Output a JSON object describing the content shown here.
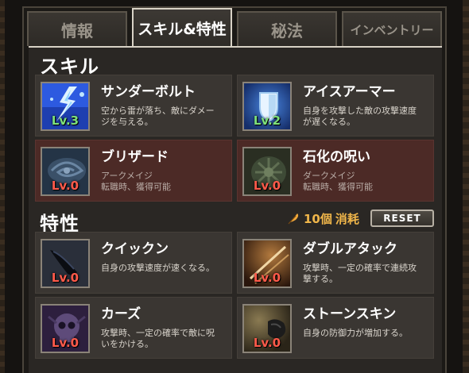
{
  "tabs": [
    {
      "label": "情報"
    },
    {
      "label": "スキル&特性"
    },
    {
      "label": "秘法"
    },
    {
      "label": "インベントリー"
    }
  ],
  "skills_section": {
    "title": "スキル"
  },
  "skills": [
    {
      "name": "サンダーボルト",
      "desc_1": "空から雷が落ち、敵にダメー",
      "desc_2": "ジを与える。",
      "level": "Lv.3",
      "icon": "thunderbolt-icon",
      "unlocked": true
    },
    {
      "name": "アイスアーマー",
      "desc_1": "自身を攻撃した敵の攻撃速度",
      "desc_2": "が遅くなる。",
      "level": "Lv.2",
      "icon": "ice-armor-icon",
      "unlocked": true
    },
    {
      "name": "ブリザード",
      "desc_1": "アークメイジ",
      "desc_2": "転職時、獲得可能",
      "level": "Lv.0",
      "icon": "blizzard-icon",
      "unlocked": false
    },
    {
      "name": "石化の呪い",
      "desc_1": "ダークメイジ",
      "desc_2": "転職時、獲得可能",
      "level": "Lv.0",
      "icon": "petrify-curse-icon",
      "unlocked": false
    }
  ],
  "traits_section": {
    "title": "特性",
    "cost_amount": "10個",
    "cost_label": "消耗",
    "reset_label": "RESET"
  },
  "traits": [
    {
      "name": "クイックン",
      "desc_1": "自身の攻撃速度が速くなる。",
      "desc_2": "",
      "level": "Lv.0",
      "icon": "quicken-icon"
    },
    {
      "name": "ダブルアタック",
      "desc_1": "攻撃時、一定の確率で連続攻",
      "desc_2": "撃する。",
      "level": "Lv.0",
      "icon": "double-attack-icon"
    },
    {
      "name": "カーズ",
      "desc_1": "攻撃時、一定の確率で敵に呪",
      "desc_2": "いをかける。",
      "level": "Lv.0",
      "icon": "curse-skull-icon"
    },
    {
      "name": "ストーンスキン",
      "desc_1": "自身の防御力が増加する。",
      "desc_2": "",
      "level": "Lv.0",
      "icon": "stone-skin-icon"
    }
  ],
  "colors": {
    "accent_gold": "#f0b64a",
    "level_active": "#7de07a",
    "level_inactive": "#ff5a4a",
    "locked_card": "#4c2a26"
  }
}
